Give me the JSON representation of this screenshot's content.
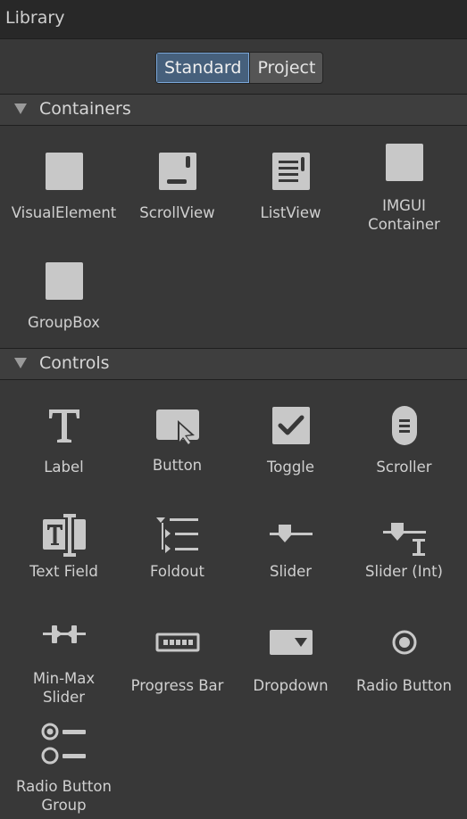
{
  "window": {
    "title": "Library"
  },
  "tabs": [
    {
      "label": "Standard",
      "active": true
    },
    {
      "label": "Project",
      "active": false
    }
  ],
  "sections": {
    "containers": {
      "title": "Containers",
      "items": [
        {
          "label": "VisualElement",
          "icon": "visual-element-icon"
        },
        {
          "label": "ScrollView",
          "icon": "scroll-view-icon"
        },
        {
          "label": "ListView",
          "icon": "list-view-icon"
        },
        {
          "label": "IMGUI\nContainer",
          "icon": "imgui-container-icon"
        },
        {
          "label": "GroupBox",
          "icon": "group-box-icon"
        }
      ]
    },
    "controls": {
      "title": "Controls",
      "items": [
        {
          "label": "Label",
          "icon": "label-icon"
        },
        {
          "label": "Button",
          "icon": "button-icon"
        },
        {
          "label": "Toggle",
          "icon": "toggle-icon"
        },
        {
          "label": "Scroller",
          "icon": "scroller-icon"
        },
        {
          "label": "Text Field",
          "icon": "text-field-icon"
        },
        {
          "label": "Foldout",
          "icon": "foldout-icon"
        },
        {
          "label": "Slider",
          "icon": "slider-icon"
        },
        {
          "label": "Slider (Int)",
          "icon": "slider-int-icon"
        },
        {
          "label": "Min-Max\nSlider",
          "icon": "min-max-slider-icon"
        },
        {
          "label": "Progress Bar",
          "icon": "progress-bar-icon"
        },
        {
          "label": "Dropdown",
          "icon": "dropdown-icon"
        },
        {
          "label": "Radio Button",
          "icon": "radio-button-icon"
        },
        {
          "label": "Radio Button\nGroup",
          "icon": "radio-button-group-icon"
        }
      ]
    }
  },
  "colors": {
    "background": "#383838",
    "title_bar": "#282828",
    "active_tab": "#46607c",
    "icon": "#c8c8c8"
  }
}
